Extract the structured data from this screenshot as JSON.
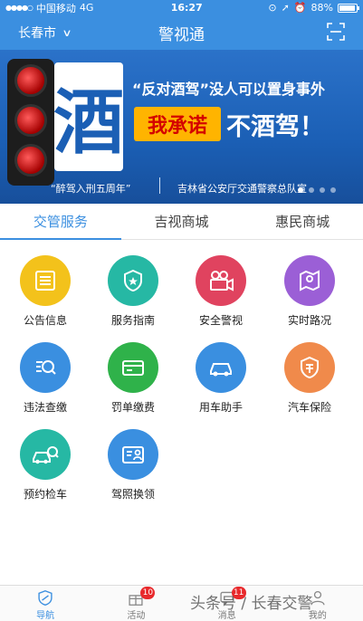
{
  "status_bar": {
    "carrier": "中国移动",
    "network": "4G",
    "time": "16:27",
    "battery": "88%"
  },
  "navbar": {
    "city": "长春市",
    "title": "警视通"
  },
  "banner": {
    "big_char": "酒",
    "slogan": "“反对酒驾”没人可以置身事外",
    "pledge_highlight": "我承诺",
    "pledge_rest": "不酒驾！",
    "footer_left": "“醉驾入刑五周年”",
    "footer_right": "吉林省公安厅交通警察总队宣"
  },
  "tabs": [
    {
      "label": "交管服务",
      "active": true
    },
    {
      "label": "吉视商城",
      "active": false
    },
    {
      "label": "惠民商城",
      "active": false
    }
  ],
  "services": [
    {
      "label": "公告信息",
      "color": "#f3c21b",
      "icon": "document-list-icon"
    },
    {
      "label": "服务指南",
      "color": "#26b8a4",
      "icon": "police-badge-icon"
    },
    {
      "label": "安全警视",
      "color": "#e0435f",
      "icon": "video-camera-icon"
    },
    {
      "label": "实时路况",
      "color": "#9b5fd6",
      "icon": "map-pin-icon"
    },
    {
      "label": "违法查缴",
      "color": "#3a8fe0",
      "icon": "search-list-icon"
    },
    {
      "label": "罚单缴费",
      "color": "#2fb24a",
      "icon": "credit-card-icon"
    },
    {
      "label": "用车助手",
      "color": "#3a8fe0",
      "icon": "car-icon"
    },
    {
      "label": "汽车保险",
      "color": "#f08a4b",
      "icon": "insurance-shield-icon"
    },
    {
      "label": "预约检车",
      "color": "#26b8a4",
      "icon": "car-inspection-icon"
    },
    {
      "label": "驾照换领",
      "color": "#3a8fe0",
      "icon": "id-card-icon"
    }
  ],
  "bottom_nav": [
    {
      "label": "导航",
      "badge": "",
      "active": true,
      "icon": "home-shield-icon"
    },
    {
      "label": "活动",
      "badge": "10",
      "active": false,
      "icon": "gift-icon"
    },
    {
      "label": "消息",
      "badge": "11",
      "active": false,
      "icon": "message-icon"
    },
    {
      "label": "我的",
      "badge": "",
      "active": false,
      "icon": "user-icon"
    }
  ],
  "watermark": "头条号 / 长春交警"
}
